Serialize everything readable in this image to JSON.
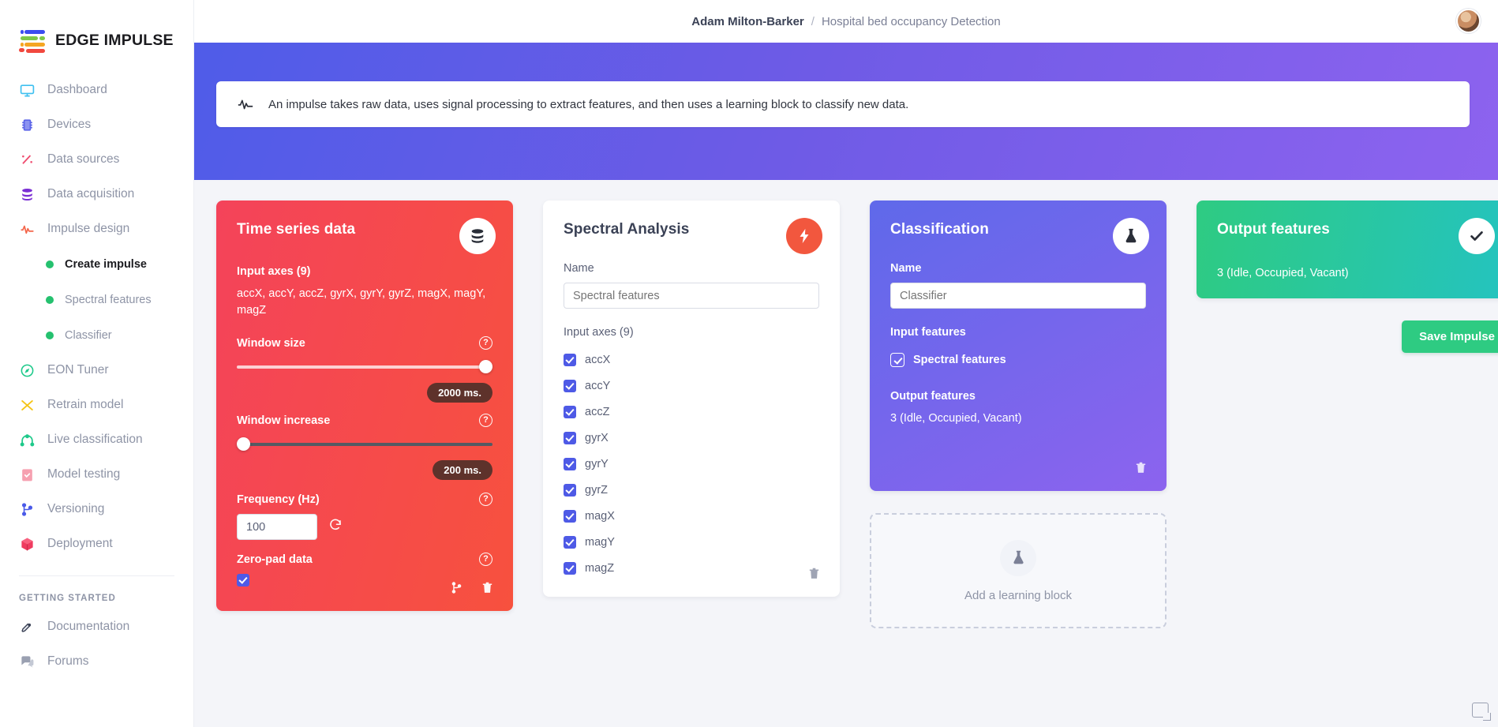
{
  "brand": {
    "name": "EDGE IMPULSE",
    "logo_icon": "edge-impulse-logo"
  },
  "sidebar": {
    "items": [
      {
        "label": "Dashboard",
        "icon": "monitor-icon",
        "active": false
      },
      {
        "label": "Devices",
        "icon": "chip-icon",
        "active": false
      },
      {
        "label": "Data sources",
        "icon": "wand-icon",
        "active": false
      },
      {
        "label": "Data acquisition",
        "icon": "database-icon",
        "active": false
      },
      {
        "label": "Impulse design",
        "icon": "pulse-icon",
        "active": false
      }
    ],
    "sub_items": [
      {
        "label": "Create impulse",
        "active": true
      },
      {
        "label": "Spectral features",
        "active": false
      },
      {
        "label": "Classifier",
        "active": false
      }
    ],
    "items_after": [
      {
        "label": "EON Tuner",
        "icon": "compass-icon"
      },
      {
        "label": "Retrain model",
        "icon": "shuffle-icon"
      },
      {
        "label": "Live classification",
        "icon": "arch-icon"
      },
      {
        "label": "Model testing",
        "icon": "clipboard-check-icon"
      },
      {
        "label": "Versioning",
        "icon": "git-branch-icon"
      },
      {
        "label": "Deployment",
        "icon": "box-icon"
      }
    ],
    "section_heading": "GETTING STARTED",
    "footer_items": [
      {
        "label": "Documentation",
        "icon": "rocket-icon"
      },
      {
        "label": "Forums",
        "icon": "chat-icon"
      }
    ]
  },
  "topbar": {
    "user": "Adam Milton-Barker",
    "separator": "/",
    "project": "Hospital bed occupancy Detection",
    "avatar_icon": "user-avatar"
  },
  "hero": {
    "icon": "pulse-icon",
    "text": "An impulse takes raw data, uses signal processing to extract features, and then uses a learning block to classify new data."
  },
  "time_series": {
    "title": "Time series data",
    "badge_icon": "database-icon",
    "input_axes_label": "Input axes (9)",
    "input_axes_value": "accX, accY, accZ, gyrX, gyrY, gyrZ, magX, magY, magZ",
    "window_size_label": "Window size",
    "window_size_value": "2000 ms.",
    "window_increase_label": "Window increase",
    "window_increase_value": "200 ms.",
    "frequency_label": "Frequency (Hz)",
    "frequency_value": "100",
    "reset_icon": "refresh-icon",
    "zero_pad_label": "Zero-pad data",
    "zero_pad_checked": true,
    "help_icon": "help-icon",
    "actions": [
      {
        "icon": "git-branch-icon"
      },
      {
        "icon": "trash-icon"
      }
    ]
  },
  "spectral": {
    "title": "Spectral Analysis",
    "badge_icon": "lightning-icon",
    "name_label": "Name",
    "name_value": "Spectral features",
    "name_placeholder": "Spectral features",
    "input_axes_label": "Input axes (9)",
    "axes": [
      {
        "label": "accX",
        "checked": true
      },
      {
        "label": "accY",
        "checked": true
      },
      {
        "label": "accZ",
        "checked": true
      },
      {
        "label": "gyrX",
        "checked": true
      },
      {
        "label": "gyrY",
        "checked": true
      },
      {
        "label": "gyrZ",
        "checked": true
      },
      {
        "label": "magX",
        "checked": true
      },
      {
        "label": "magY",
        "checked": true
      },
      {
        "label": "magZ",
        "checked": true
      }
    ],
    "actions": [
      {
        "icon": "trash-icon"
      }
    ]
  },
  "classification": {
    "title": "Classification",
    "badge_icon": "flask-icon",
    "name_label": "Name",
    "name_value": "Classifier",
    "name_placeholder": "Classifier",
    "input_features_label": "Input features",
    "input_feature_item": "Spectral features",
    "input_feature_checked": true,
    "output_features_label": "Output features",
    "output_features_value": "3 (Idle, Occupied, Vacant)",
    "actions": [
      {
        "icon": "trash-icon"
      }
    ]
  },
  "add_learning_block": {
    "label": "Add a learning block",
    "icon": "flask-icon"
  },
  "output": {
    "title": "Output features",
    "badge_icon": "check-icon",
    "value": "3 (Idle, Occupied, Vacant)"
  },
  "save": {
    "label": "Save Impulse"
  },
  "feedback": {
    "icon": "feedback-icon"
  },
  "colors": {
    "red_start": "#f4435a",
    "red_end": "#f7513e",
    "purple_start": "#5f69ea",
    "purple_end": "#8c63ee",
    "green_start": "#2ecb82",
    "green_end": "#24c3c0",
    "hero_start": "#4f5ce8",
    "hero_end": "#8d63ef",
    "checkbox_blue": "#4e5ae6",
    "dot_green": "#25c16f",
    "pill_dark": "#5e322b"
  }
}
